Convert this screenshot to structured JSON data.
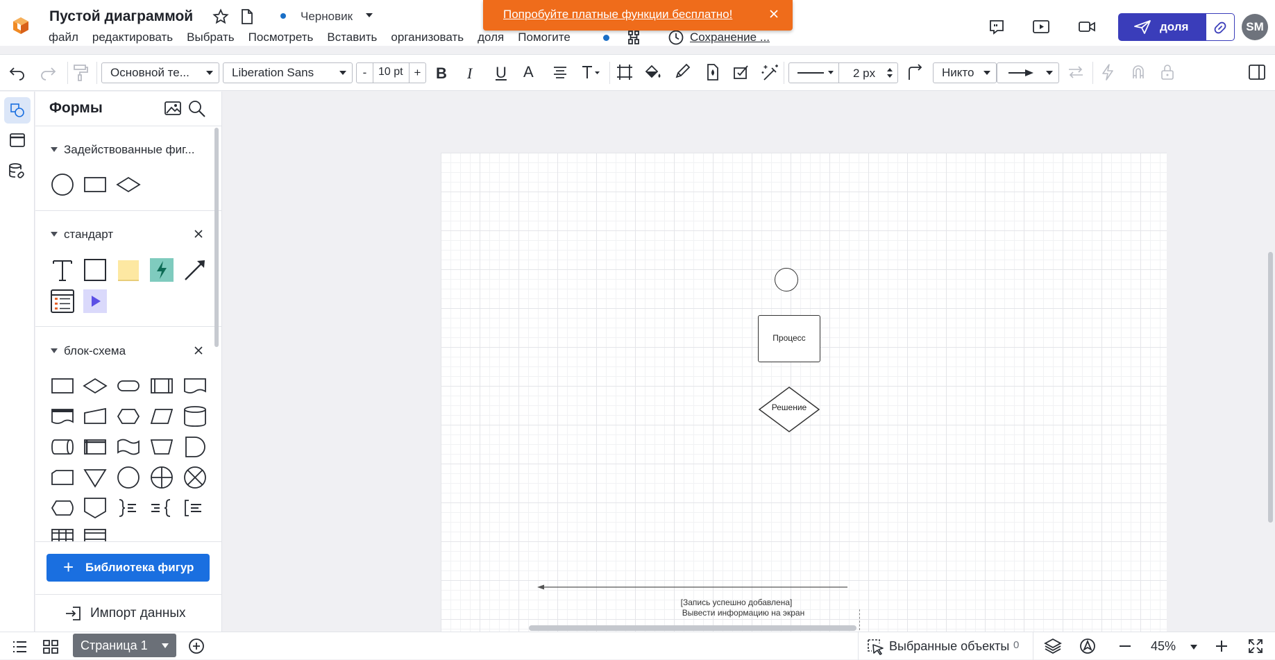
{
  "header": {
    "doc_title": "Пустой диаграммой",
    "status": "Черновик",
    "save_status": "Сохранение ...",
    "menu": [
      "файл",
      "редактировать",
      "Выбрать",
      "Посмотреть",
      "Вставить",
      "организовать",
      "доля",
      "Помогите"
    ],
    "share_label": "доля",
    "avatar_initials": "SM"
  },
  "promo": {
    "text": "Попробуйте платные функции бесплатно!"
  },
  "toolbar": {
    "theme_select": "Основной те...",
    "font_select": "Liberation Sans",
    "font_size": "10 pt",
    "size_minus": "-",
    "size_plus": "+",
    "bold": "B",
    "italic": "I",
    "underline": "U",
    "font_color": "A",
    "line_width": "2 px",
    "endpoint_select": "Никто"
  },
  "panel": {
    "title": "Формы",
    "sections": [
      {
        "label": "Задействованные фиг..."
      },
      {
        "label": "стандарт"
      },
      {
        "label": "блок-схема"
      }
    ],
    "library_label": "Библиотека фигур",
    "library_plus": "+",
    "import_label": "Импорт данных"
  },
  "canvas": {
    "process_label": "Процесс",
    "decision_label": "Решение",
    "note_line1": "[Запись успешно добавлена]",
    "note_line2": "Вывести информацию на экран"
  },
  "bottom": {
    "page_tab": "Страница 1",
    "selected_label": "Выбранные объекты",
    "selected_count": "0",
    "zoom": "45%"
  },
  "colors": {
    "accent": "#3a3dba",
    "promo": "#ef6c1b",
    "library_button": "#1a6fe0",
    "status_dot": "#1a6fc7"
  }
}
